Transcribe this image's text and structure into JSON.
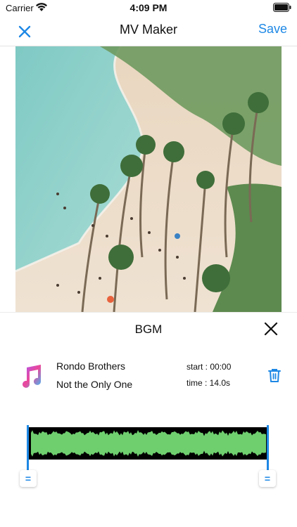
{
  "status": {
    "carrier": "Carrier",
    "time": "4:09 PM"
  },
  "nav": {
    "title": "MV Maker",
    "save_label": "Save"
  },
  "bgm": {
    "title": "BGM",
    "artist": "Rondo Brothers",
    "song": "Not the Only One",
    "start": "start : 00:00",
    "time": "time : 14.0s"
  },
  "trim_handles": {
    "left_label": "=",
    "right_label": "="
  },
  "colors": {
    "accent": "#1e88e5",
    "waveform": "#6fcf6f"
  },
  "icons": [
    "wifi-icon",
    "battery-icon",
    "close-icon",
    "music-note-icon",
    "trash-icon"
  ]
}
